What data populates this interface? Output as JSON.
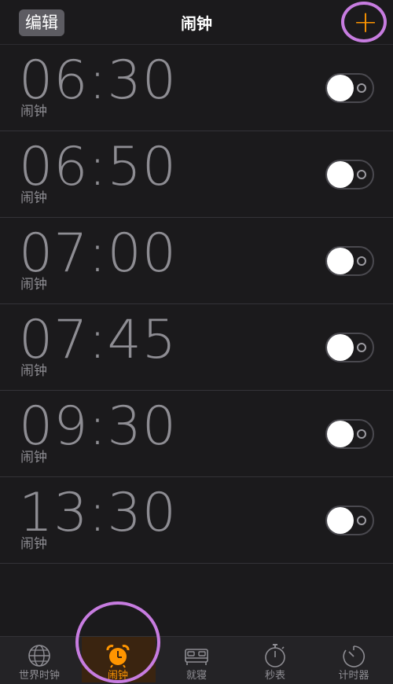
{
  "header": {
    "edit_label": "编辑",
    "title": "闹钟",
    "add_label": "+"
  },
  "alarms": [
    {
      "time": "06:30",
      "label": "闹钟",
      "enabled": false
    },
    {
      "time": "06:50",
      "label": "闹钟",
      "enabled": false
    },
    {
      "time": "07:00",
      "label": "闹钟",
      "enabled": false
    },
    {
      "time": "07:45",
      "label": "闹钟",
      "enabled": false
    },
    {
      "time": "09:30",
      "label": "闹钟",
      "enabled": false
    },
    {
      "time": "13:30",
      "label": "闹钟",
      "enabled": false
    }
  ],
  "tabs": [
    {
      "label": "世界时钟",
      "icon": "globe-icon",
      "active": false
    },
    {
      "label": "闹钟",
      "icon": "alarm-clock-icon",
      "active": true
    },
    {
      "label": "就寝",
      "icon": "bed-icon",
      "active": false
    },
    {
      "label": "秒表",
      "icon": "stopwatch-icon",
      "active": false
    },
    {
      "label": "计时器",
      "icon": "timer-icon",
      "active": false
    }
  ],
  "colors": {
    "accent": "#ff9500",
    "background": "#1b1a1c",
    "text_dim": "#8e8d93",
    "highlight_ring": "#c77ce0"
  }
}
